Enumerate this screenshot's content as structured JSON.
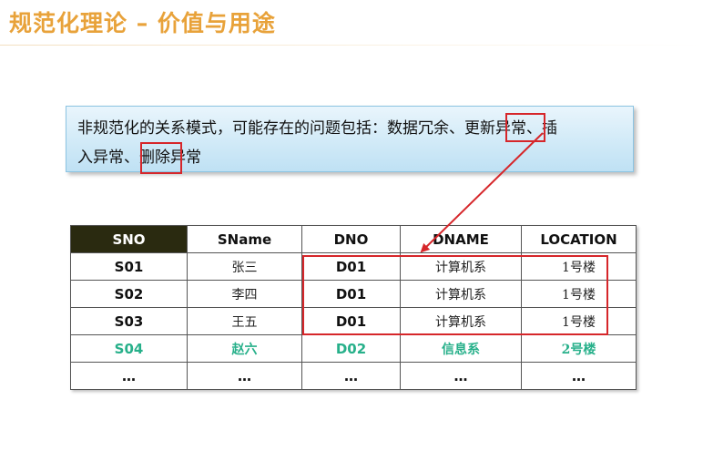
{
  "slide": {
    "title": "规范化理论 – 价值与用途"
  },
  "callout": {
    "segments": [
      "非规范化的关系模式，可能存在的问题包括：数据冗余、",
      "更新",
      "异常、插",
      "入异常、",
      "删除",
      "异常"
    ],
    "highlight_color": "#d6262a"
  },
  "table": {
    "headers": [
      "SNO",
      "SName",
      "DNO",
      "DNAME",
      "LOCATION"
    ],
    "rows": [
      [
        "S01",
        "张三",
        "D01",
        "计算机系",
        "1号楼"
      ],
      [
        "S02",
        "李四",
        "D01",
        "计算机系",
        "1号楼"
      ],
      [
        "S03",
        "王五",
        "D01",
        "计算机系",
        "1号楼"
      ],
      [
        "S04",
        "赵六",
        "D02",
        "信息系",
        "2号楼"
      ],
      [
        "…",
        "…",
        "…",
        "…",
        "…"
      ]
    ],
    "highlight_row_color": "#27b08a"
  },
  "colors": {
    "title": "#e8a23a",
    "header_dark": "#2a2a10",
    "annotation_red": "#d6262a"
  }
}
